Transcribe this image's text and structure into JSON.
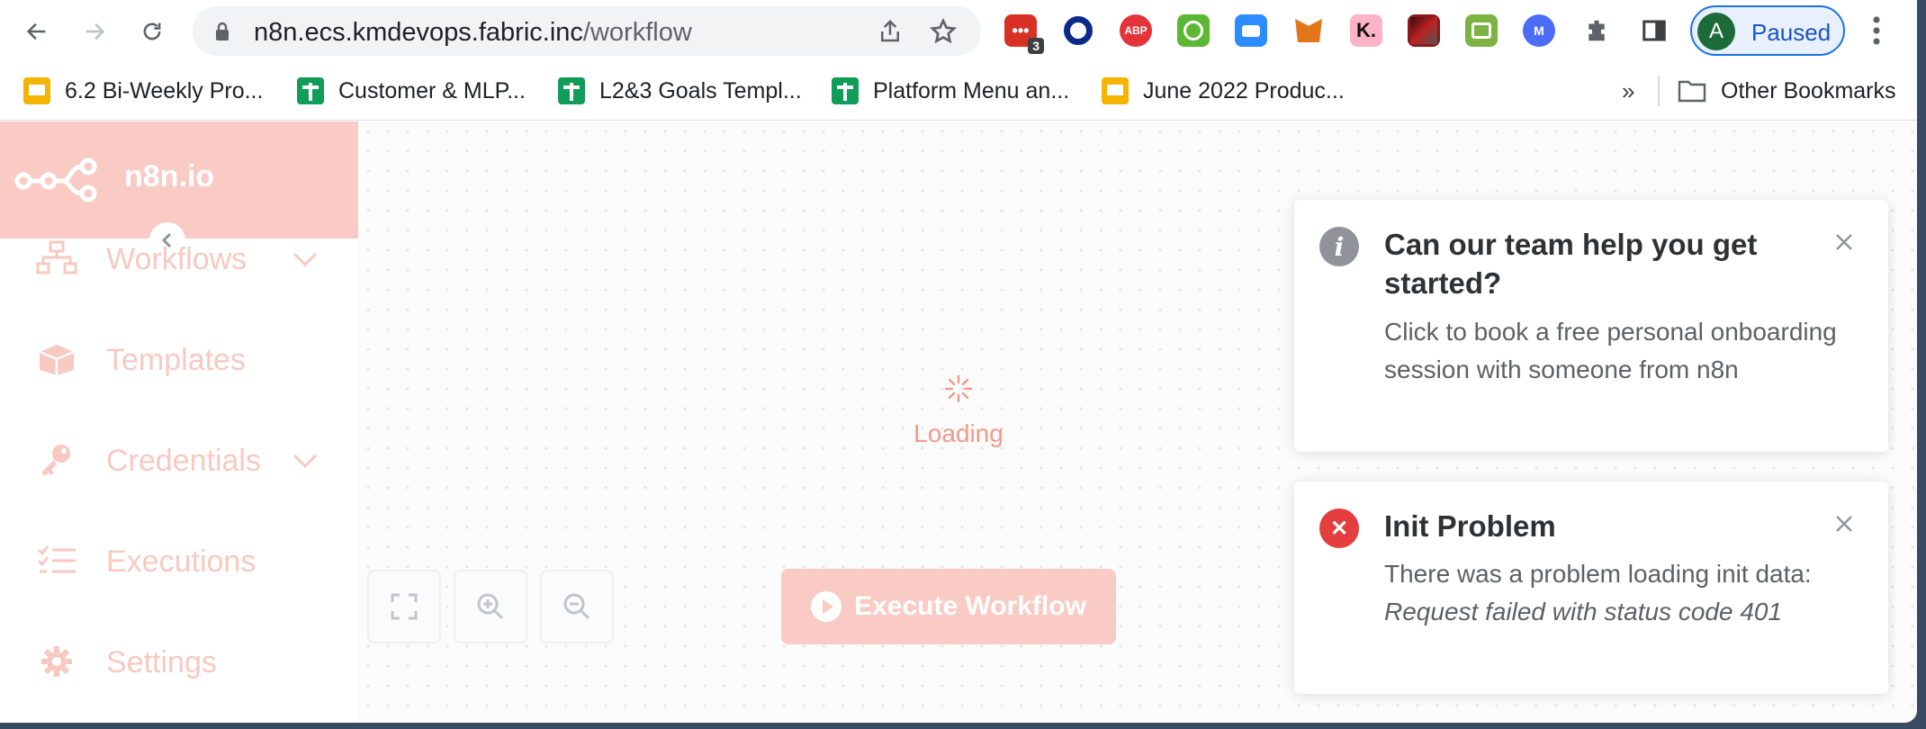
{
  "browser": {
    "url_host": "n8n.ecs.kmdevops.fabric.inc",
    "url_path": "/workflow",
    "ext_badge": "3",
    "ext_abp": "ABP",
    "ext_k": "K.",
    "ext_m": "M",
    "profile_initial": "A",
    "profile_label": "Paused",
    "bookmarks": [
      {
        "label": "6.2 Bi-Weekly Pro...",
        "icon": "slides-icon"
      },
      {
        "label": "Customer & MLP...",
        "icon": "sheets-icon"
      },
      {
        "label": "L2&3 Goals Templ...",
        "icon": "sheets-icon"
      },
      {
        "label": "Platform Menu an...",
        "icon": "sheets-icon"
      },
      {
        "label": "June 2022 Produc...",
        "icon": "slides-icon"
      }
    ],
    "more": "»",
    "other_bookmarks": "Other Bookmarks"
  },
  "app": {
    "brand": "n8n.io",
    "accent": "#f9cbc4",
    "sidebar": {
      "items": [
        {
          "label": "Workflows",
          "icon": "workflows-icon",
          "expandable": true
        },
        {
          "label": "Templates",
          "icon": "box-icon",
          "expandable": false
        },
        {
          "label": "Credentials",
          "icon": "key-icon",
          "expandable": true
        },
        {
          "label": "Executions",
          "icon": "list-icon",
          "expandable": false
        },
        {
          "label": "Settings",
          "icon": "gear-icon",
          "expandable": false
        }
      ]
    },
    "canvas": {
      "loading_text": "Loading",
      "execute_label": "Execute Workflow"
    },
    "notifications": [
      {
        "type": "info",
        "title": "Can our team help you get started?",
        "body": "Click to book a free personal onboarding session with someone from n8n"
      },
      {
        "type": "error",
        "title": "Init Problem",
        "body": "There was a problem loading init data:",
        "detail": "Request failed with status code 401"
      }
    ]
  }
}
